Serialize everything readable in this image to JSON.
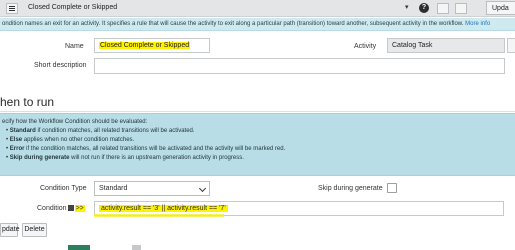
{
  "header": {
    "title": "Closed Complete or Skipped",
    "help_icon": "?",
    "update_label": "Upda"
  },
  "info_banner": {
    "text": "ondition names an exit for an activity. It specifies a rule that will cause the activity to exit along a particular path (transition) toward another, subsequent activity in the workflow.",
    "more_info": "More info"
  },
  "form": {
    "name_label": "Name",
    "name_value": "Closed Complete or Skipped",
    "activity_label": "Activity",
    "activity_value": "Catalog Task",
    "short_description_label": "Short description",
    "short_description_value": ""
  },
  "section": {
    "title": "hen to run"
  },
  "help_panel": {
    "intro": "ecify how the Workflow Condition should be evaluated:",
    "items": [
      {
        "term": "Standard",
        "rest": " if condition matches, all related transitions will be activated."
      },
      {
        "term": "Else",
        "rest": " applies when no other condition matches."
      },
      {
        "term": "Error",
        "rest": " if the condition matches, all related transitions will be activated and the activity will be marked red."
      },
      {
        "term": "Skip during generate",
        "rest": " will not run if there is an upstream generation activity in progress."
      }
    ]
  },
  "condition": {
    "type_label": "Condition Type",
    "type_value": "Standard",
    "skip_label": "Skip during generate",
    "skip_checked": false,
    "condition_label_prefix": "Condition",
    "condition_label_suffix": ">>",
    "condition_value": "activity.result == '3' || activity.result == '7'"
  },
  "buttons": {
    "update": "pdate",
    "delete": "Delete"
  },
  "colors": {
    "highlight": "#fff200",
    "info_bg": "#cfe9f0",
    "panel_bg": "#b9dde6",
    "link": "#1f74b8"
  }
}
